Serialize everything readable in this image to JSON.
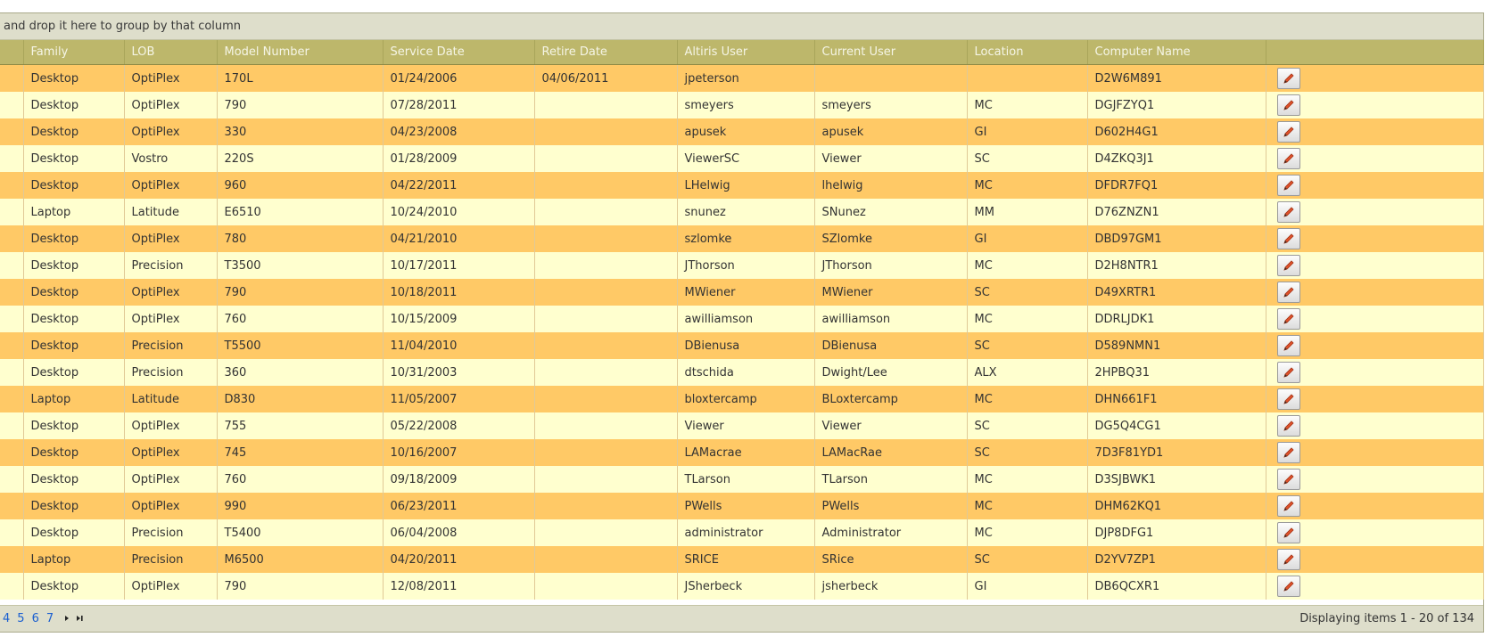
{
  "group_panel": {
    "hint": "and drop it here to group by that column"
  },
  "columns": [
    "Family",
    "LOB",
    "Model Number",
    "Service Date",
    "Retire Date",
    "Altiris User",
    "Current User",
    "Location",
    "Computer Name"
  ],
  "rows": [
    [
      "Desktop",
      "OptiPlex",
      "170L",
      "01/24/2006",
      "04/06/2011",
      "jpeterson",
      "",
      "",
      "D2W6M891"
    ],
    [
      "Desktop",
      "OptiPlex",
      "790",
      "07/28/2011",
      "",
      "smeyers",
      "smeyers",
      "MC",
      "DGJFZYQ1"
    ],
    [
      "Desktop",
      "OptiPlex",
      "330",
      "04/23/2008",
      "",
      "apusek",
      "apusek",
      "GI",
      "D602H4G1"
    ],
    [
      "Desktop",
      "Vostro",
      "220S",
      "01/28/2009",
      "",
      "ViewerSC",
      "Viewer",
      "SC",
      "D4ZKQ3J1"
    ],
    [
      "Desktop",
      "OptiPlex",
      "960",
      "04/22/2011",
      "",
      "LHelwig",
      "lhelwig",
      "MC",
      "DFDR7FQ1"
    ],
    [
      "Laptop",
      "Latitude",
      "E6510",
      "10/24/2010",
      "",
      "snunez",
      "SNunez",
      "MM",
      "D76ZNZN1"
    ],
    [
      "Desktop",
      "OptiPlex",
      "780",
      "04/21/2010",
      "",
      "szlomke",
      "SZlomke",
      "GI",
      "DBD97GM1"
    ],
    [
      "Desktop",
      "Precision",
      "T3500",
      "10/17/2011",
      "",
      "JThorson",
      "JThorson",
      "MC",
      "D2H8NTR1"
    ],
    [
      "Desktop",
      "OptiPlex",
      "790",
      "10/18/2011",
      "",
      "MWiener",
      "MWiener",
      "SC",
      "D49XRTR1"
    ],
    [
      "Desktop",
      "OptiPlex",
      "760",
      "10/15/2009",
      "",
      "awilliamson",
      "awilliamson",
      "MC",
      "DDRLJDK1"
    ],
    [
      "Desktop",
      "Precision",
      "T5500",
      "11/04/2010",
      "",
      "DBienusa",
      "DBienusa",
      "SC",
      "D589NMN1"
    ],
    [
      "Desktop",
      "Precision",
      "360",
      "10/31/2003",
      "",
      "dtschida",
      "Dwight/Lee",
      "ALX",
      "2HPBQ31"
    ],
    [
      "Laptop",
      "Latitude",
      "D830",
      "11/05/2007",
      "",
      "bloxtercamp",
      "BLoxtercamp",
      "MC",
      "DHN661F1"
    ],
    [
      "Desktop",
      "OptiPlex",
      "755",
      "05/22/2008",
      "",
      "Viewer",
      "Viewer",
      "SC",
      "DG5Q4CG1"
    ],
    [
      "Desktop",
      "OptiPlex",
      "745",
      "10/16/2007",
      "",
      "LAMacrae",
      "LAMacRae",
      "SC",
      "7D3F81YD1"
    ],
    [
      "Desktop",
      "OptiPlex",
      "760",
      "09/18/2009",
      "",
      "TLarson",
      "TLarson",
      "MC",
      "D3SJBWK1"
    ],
    [
      "Desktop",
      "OptiPlex",
      "990",
      "06/23/2011",
      "",
      "PWells",
      "PWells",
      "MC",
      "DHM62KQ1"
    ],
    [
      "Desktop",
      "Precision",
      "T5400",
      "06/04/2008",
      "",
      "administrator",
      "Administrator",
      "MC",
      "DJP8DFG1"
    ],
    [
      "Laptop",
      "Precision",
      "M6500",
      "04/20/2011",
      "",
      "SRICE",
      "SRice",
      "SC",
      "D2YV7ZP1"
    ],
    [
      "Desktop",
      "OptiPlex",
      "790",
      "12/08/2011",
      "",
      "JSherbeck",
      "jsherbeck",
      "GI",
      "DB6QCXR1"
    ]
  ],
  "pager": {
    "pages": [
      "4",
      "5",
      "6",
      "7"
    ],
    "next_icon": "next-page-icon",
    "last_icon": "last-page-icon",
    "info": "Displaying items 1 - 20 of 134"
  },
  "colors": {
    "header": "#bdb76b",
    "row_odd": "#ffc966",
    "row_even": "#ffffcf",
    "panel": "#dedecb",
    "link": "#1a5fd0"
  },
  "icons": {
    "edit": "pencil-icon"
  }
}
